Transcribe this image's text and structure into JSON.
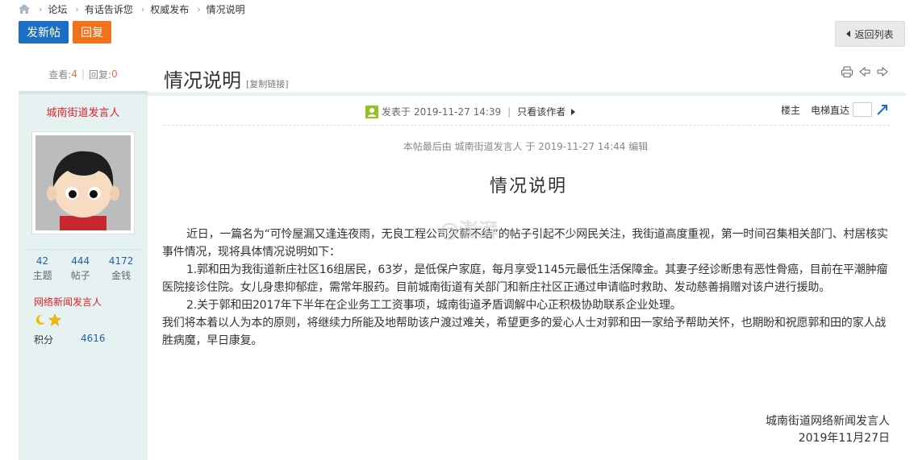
{
  "breadcrumb": {
    "items": [
      "论坛",
      "有话告诉您",
      "权威发布",
      "情况说明"
    ]
  },
  "toolbar": {
    "new_post": "发新帖",
    "reply": "回复",
    "back": "返回列表"
  },
  "sidebar": {
    "views_label": "查看:",
    "views": "4",
    "replies_label": "回复:",
    "replies": "0",
    "author": "城南街道发言人",
    "stats": [
      {
        "value": "42",
        "label": "主题"
      },
      {
        "value": "444",
        "label": "帖子"
      },
      {
        "value": "4172",
        "label": "金钱"
      }
    ],
    "group": "网络新闻发言人",
    "score_label": "积分",
    "score": "4616"
  },
  "thread": {
    "title": "情况说明",
    "copy_link": "[复制链接]",
    "posted_prefix": "发表于",
    "posted_time": "2019-11-27 14:39",
    "only_author": "只看该作者",
    "floor_label": "楼主",
    "elevator_label": "电梯直达",
    "edit_note": "本帖最后由 城南街道发言人 于 2019-11-27 14:44 编辑",
    "post_title": "情况说明",
    "paragraphs": [
      "近日，一篇名为“可怜屋漏又逢连夜雨，无良工程公司欠薪不结”的帖子引起不少网民关注，我街道高度重视，第一时间召集相关部门、村居核实事件情况，现将具体情况说明如下：",
      "1.郭和田为我街道新庄社区16组居民，63岁，是低保户家庭，每月享受1145元最低生活保障金。其妻子经诊断患有恶性骨癌，目前在平潮肿瘤医院接诊住院。女儿身患抑郁症，需常年服药。目前城南街道有关部门和新庄社区正通过申请临时救助、发动慈善捐赠对该户进行援助。",
      "2.关于郭和田2017年下半年在企业务工工资事项，城南街道矛盾调解中心正积极协助联系企业处理。",
      "我们将本着以人为本的原则，将继续力所能及地帮助该户渡过难关，希望更多的爱心人士对郭和田一家给予帮助关怀，也期盼和祝愿郭和田的家人战胜病魔，早日康复。"
    ],
    "signature": "城南街道网络新闻发言人",
    "date": "2019年11月27日"
  },
  "watermark": "@澎湃"
}
